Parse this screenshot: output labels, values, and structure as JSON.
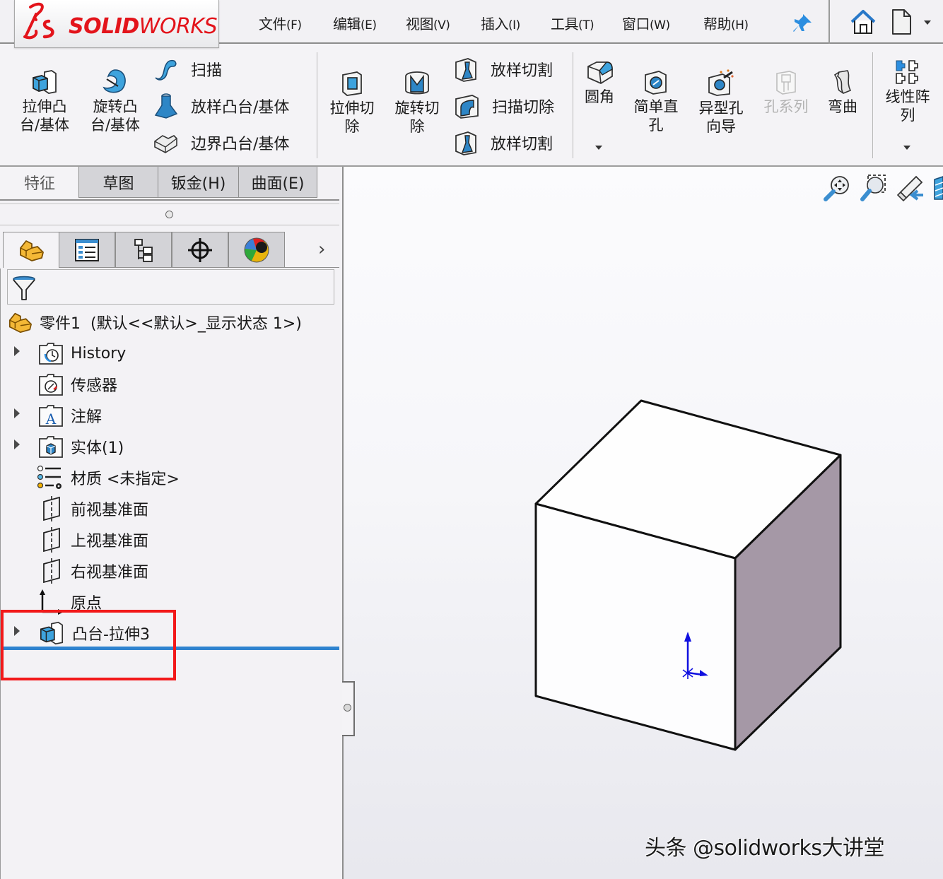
{
  "app": {
    "logo_prefix": "DS",
    "logo_bold": "SOLID",
    "logo_light": "WORKS"
  },
  "menu": {
    "items": [
      {
        "label": "文件",
        "key": "(F)"
      },
      {
        "label": "编辑",
        "key": "(E)"
      },
      {
        "label": "视图",
        "key": "(V)"
      },
      {
        "label": "插入",
        "key": "(I)"
      },
      {
        "label": "工具",
        "key": "(T)"
      },
      {
        "label": "窗口",
        "key": "(W)"
      },
      {
        "label": "帮助",
        "key": "(H)"
      }
    ],
    "icons": [
      "pin-icon",
      "home-icon",
      "new-document-icon",
      "dropdown-icon"
    ]
  },
  "ribbon": {
    "extrude_boss": {
      "line1": "拉伸凸",
      "line2": "台/基体"
    },
    "revolve_boss": {
      "line1": "旋转凸",
      "line2": "台/基体"
    },
    "sweep": "扫描",
    "loft_boss": "放样凸台/基体",
    "boundary_boss": "边界凸台/基体",
    "extrude_cut": {
      "line1": "拉伸切",
      "line2": "除"
    },
    "revolve_cut": {
      "line1": "旋转切",
      "line2": "除"
    },
    "loft_cut": "放样切割",
    "swept_cut": "扫描切除",
    "boundary_cut": "放样切割",
    "fillet": "圆角",
    "simple_hole": {
      "line1": "简单直",
      "line2": "孔"
    },
    "hole_wizard": {
      "line1": "异型孔",
      "line2": "向导"
    },
    "hole_series": "孔系列",
    "flex": "弯曲",
    "linear_pattern": {
      "line1": "线性阵",
      "line2": "列"
    }
  },
  "command_tabs": [
    "特征",
    "草图",
    "钣金(H)",
    "曲面(E)"
  ],
  "active_command_tab": "特征",
  "manager_tabs": [
    "feature-manager",
    "property-manager",
    "configuration-manager",
    "dimxpert-manager",
    "display-manager"
  ],
  "tree": {
    "root": "零件1  (默认<<默认>_显示状态 1>)",
    "items": [
      {
        "label": "History",
        "expandable": true
      },
      {
        "label": "传感器",
        "expandable": false
      },
      {
        "label": "注解",
        "expandable": true
      },
      {
        "label": "实体(1)",
        "expandable": true
      },
      {
        "label": "材质 <未指定>",
        "expandable": false
      },
      {
        "label": "前视基准面",
        "expandable": false
      },
      {
        "label": "上视基准面",
        "expandable": false
      },
      {
        "label": "右视基准面",
        "expandable": false
      },
      {
        "label": "原点",
        "expandable": false
      },
      {
        "label": "凸台-拉伸3",
        "expandable": true,
        "highlighted": true
      }
    ]
  },
  "view_toolbar": [
    "zoom-to-fit-icon",
    "zoom-to-area-icon",
    "previous-view-icon",
    "section-view-icon"
  ],
  "watermark": "头条 @solidworks大讲堂",
  "colors": {
    "brand_red": "#e3141b",
    "highlight_red": "#f2191a",
    "rollback_blue": "#2e83cf",
    "cube_side": "#a598a6",
    "triad_blue": "#1010e0"
  }
}
